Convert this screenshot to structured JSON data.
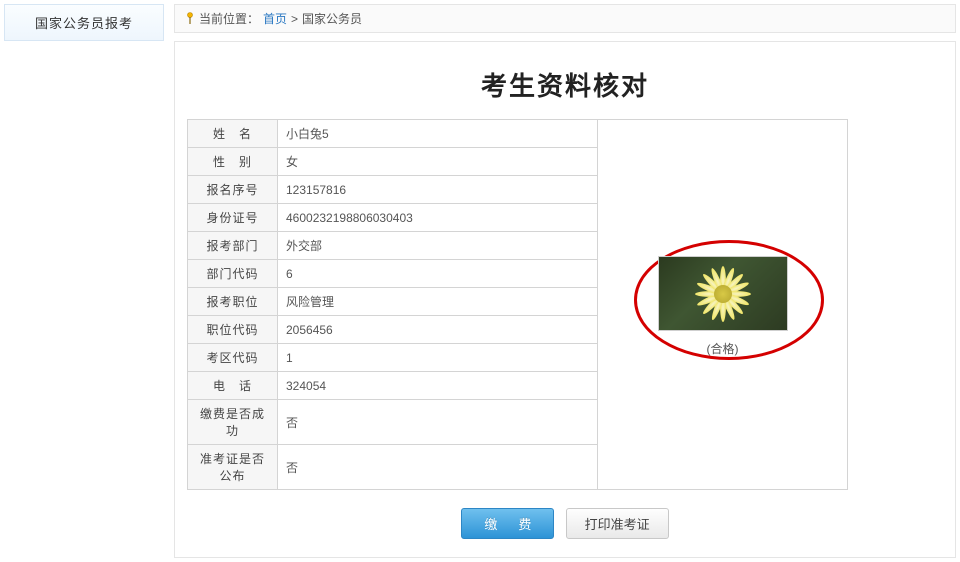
{
  "sidebar": {
    "item": "国家公务员报考"
  },
  "breadcrumb": {
    "prefix": "当前位置：",
    "home": "首页",
    "sep": " >",
    "current": "国家公务员"
  },
  "pageTitle": "考生资料核对",
  "fields": [
    {
      "label": "姓　名",
      "value": "小白兔5"
    },
    {
      "label": "性　别",
      "value": "女"
    },
    {
      "label": "报名序号",
      "value": "123157816"
    },
    {
      "label": "身份证号",
      "value": "4600232198806030403"
    },
    {
      "label": "报考部门",
      "value": "外交部"
    },
    {
      "label": "部门代码",
      "value": "6"
    },
    {
      "label": "报考职位",
      "value": "风险管理"
    },
    {
      "label": "职位代码",
      "value": "2056456"
    },
    {
      "label": "考区代码",
      "value": "1"
    },
    {
      "label": "电　话",
      "value": "324054"
    },
    {
      "label": "缴费是否成功",
      "value": "否"
    },
    {
      "label": "准考证是否公布",
      "value": "否"
    }
  ],
  "photo": {
    "status": "(合格)"
  },
  "actions": {
    "pay": "缴　费",
    "printTicket": "打印准考证"
  }
}
